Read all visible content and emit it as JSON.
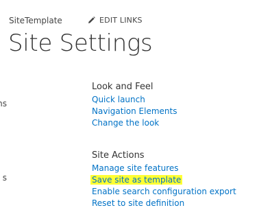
{
  "breadcrumb": {
    "site_name": "SiteTemplate"
  },
  "header": {
    "edit_links_label": "EDIT LINKS"
  },
  "page": {
    "title": "Site Settings"
  },
  "left_clipped": {
    "text_1": "ns",
    "text_2": "s"
  },
  "sections": {
    "look_and_feel": {
      "heading": "Look and Feel",
      "links": [
        "Quick launch",
        "Navigation Elements",
        "Change the look"
      ]
    },
    "site_actions": {
      "heading": "Site Actions",
      "links": [
        "Manage site features",
        "Save site as template",
        "Enable search configuration export",
        "Reset to site definition"
      ]
    }
  },
  "colors": {
    "link": "#0072c6",
    "highlight": "#ffff33",
    "text": "#333333"
  },
  "icons": {
    "edit": "pencil-icon"
  }
}
